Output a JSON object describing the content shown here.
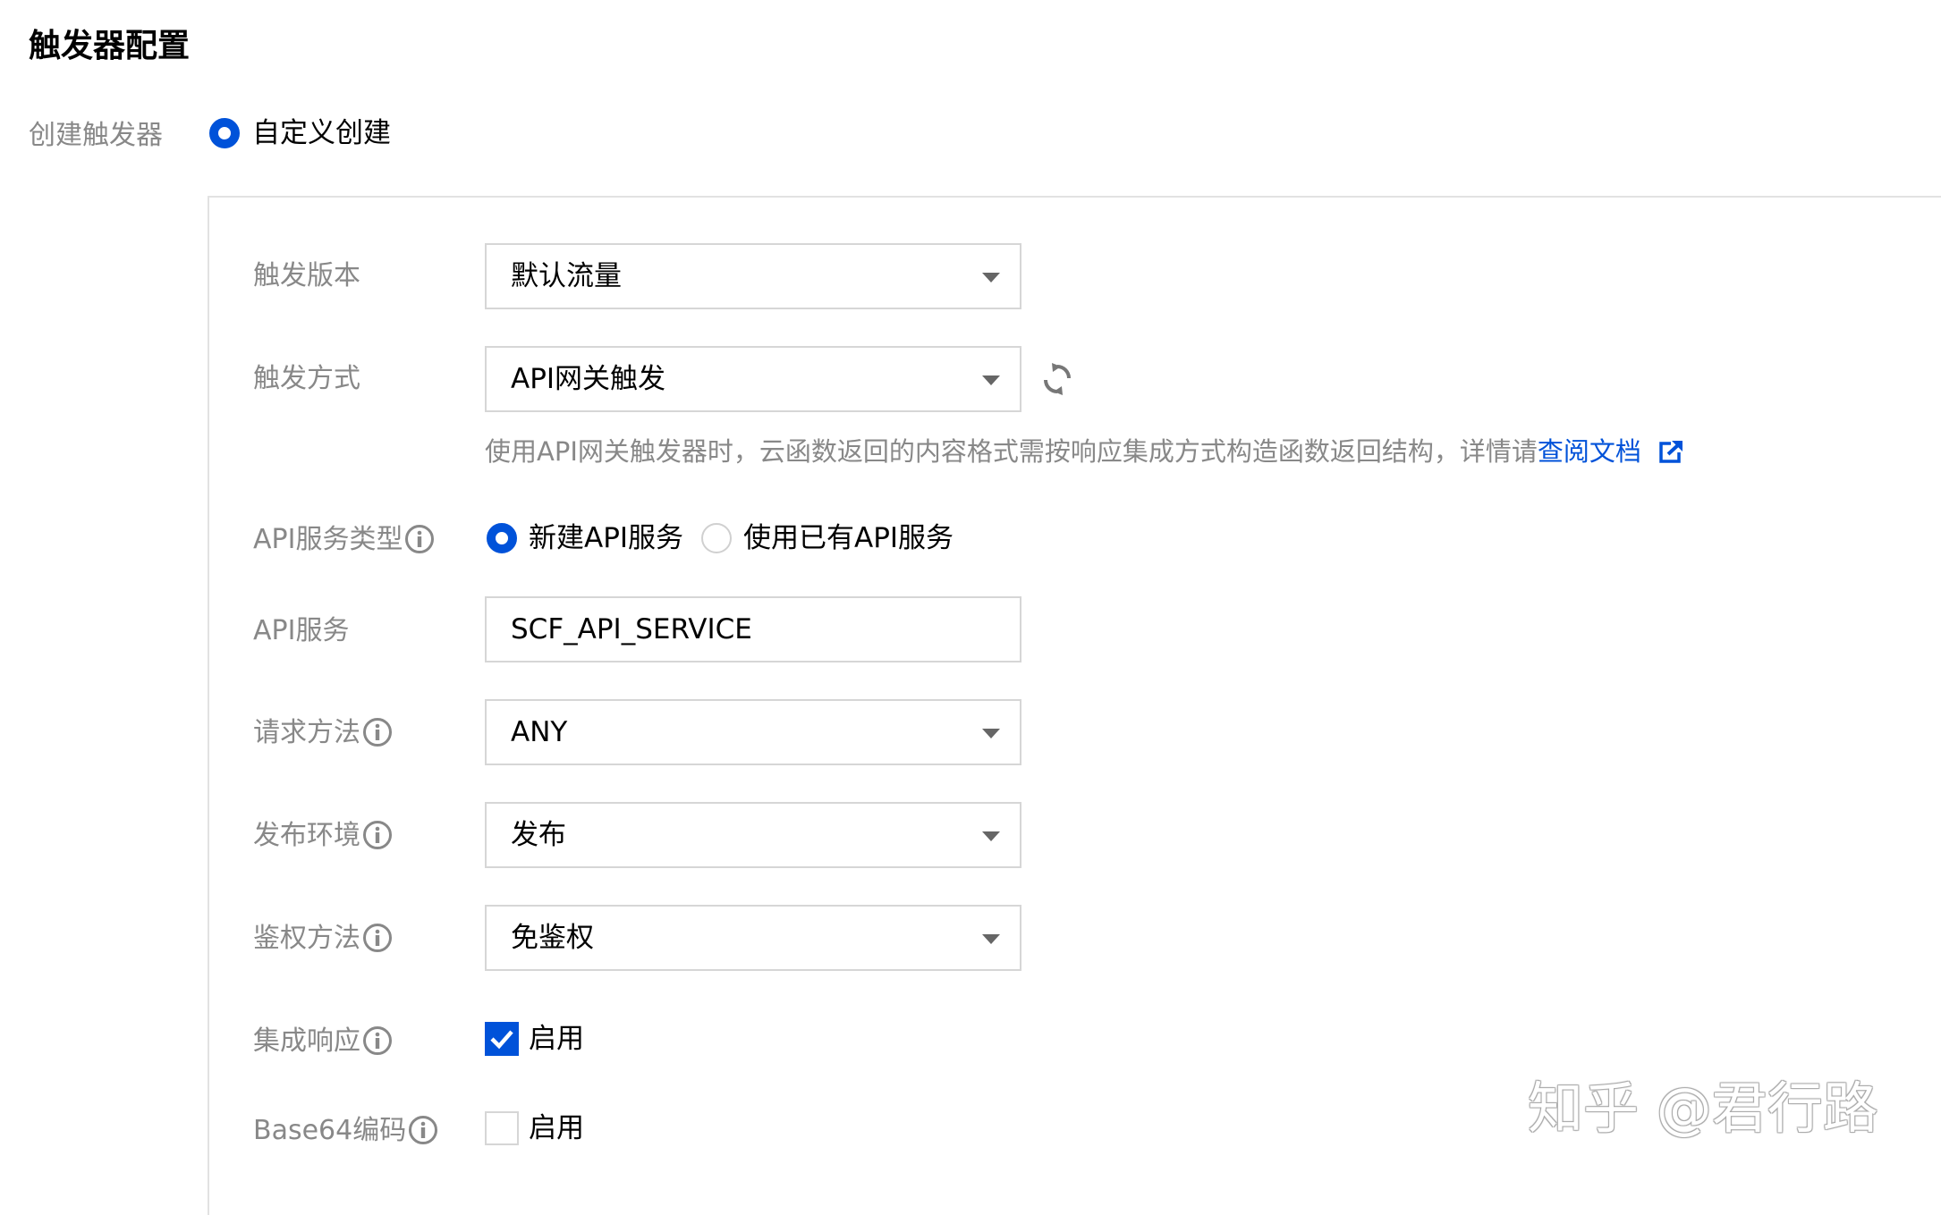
{
  "title": "触发器配置",
  "create_trigger": {
    "label": "创建触发器",
    "option": "自定义创建"
  },
  "form": {
    "trigger_version": {
      "label": "触发版本",
      "value": "默认流量"
    },
    "trigger_method": {
      "label": "触发方式",
      "value": "API网关触发"
    },
    "hint": {
      "text": "使用API网关触发器时，云函数返回的内容格式需按响应集成方式构造函数返回结构，详情请",
      "link": "查阅文档"
    },
    "api_service_type": {
      "label": "API服务类型",
      "option_new": "新建API服务",
      "option_existing": "使用已有API服务"
    },
    "api_service": {
      "label": "API服务",
      "value": "SCF_API_SERVICE"
    },
    "request_method": {
      "label": "请求方法",
      "value": "ANY"
    },
    "publish_env": {
      "label": "发布环境",
      "value": "发布"
    },
    "auth_method": {
      "label": "鉴权方法",
      "value": "免鉴权"
    },
    "integrated_response": {
      "label": "集成响应",
      "checkbox_label": "启用",
      "checked": true
    },
    "base64": {
      "label": "Base64编码",
      "checkbox_label": "启用",
      "checked": false
    }
  },
  "watermark": "知乎 @君行路",
  "colors": {
    "accent": "#0052d9",
    "label": "#888888",
    "border": "#d6d6d6"
  },
  "icons": [
    "info-icon",
    "refresh-icon",
    "external-link-icon",
    "chevron-down-icon",
    "check-icon"
  ]
}
